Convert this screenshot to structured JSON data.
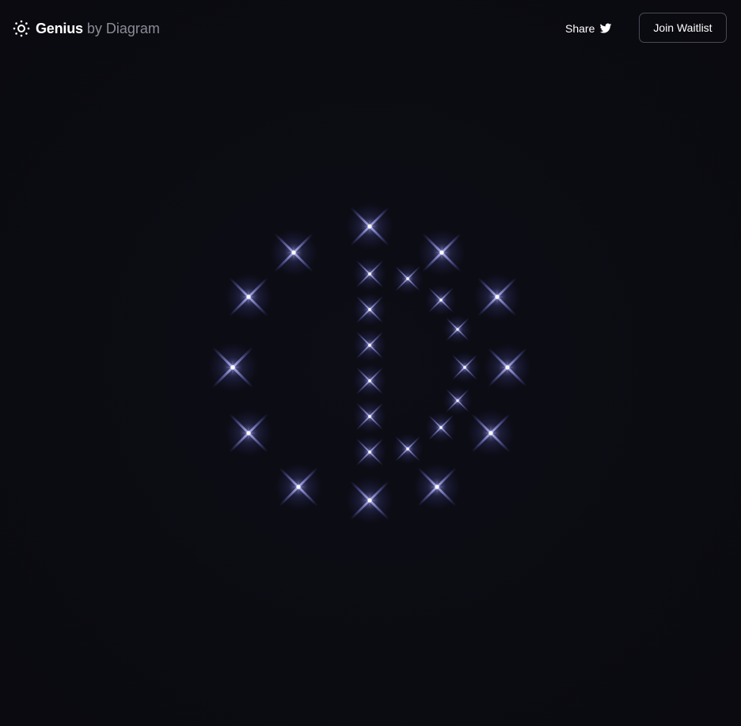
{
  "header": {
    "brand_name": "Genius",
    "brand_by": "by Diagram",
    "brand_icon": "sun-icon",
    "share_label": "Share",
    "share_icon": "twitter-bird-icon",
    "join_label": "Join Waitlist"
  },
  "colors": {
    "background": "#0b0b12",
    "sparkle_core": "#ffffff",
    "sparkle_glow": "#7b7dff",
    "button_border": "#4a4a55",
    "muted_text": "#8b8b95"
  }
}
